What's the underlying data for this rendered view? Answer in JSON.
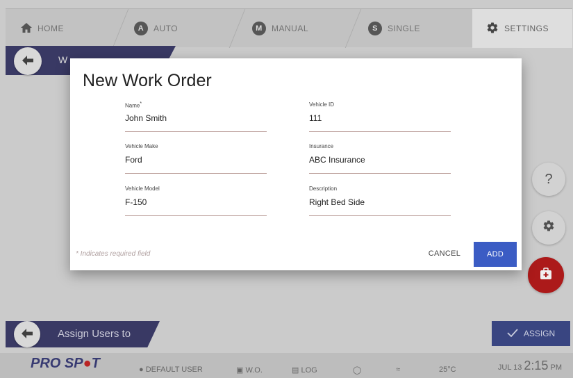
{
  "tabs": [
    {
      "label": "HOME",
      "icon": "home-icon"
    },
    {
      "label": "AUTO",
      "badge": "A"
    },
    {
      "label": "MANUAL",
      "badge": "M"
    },
    {
      "label": "SINGLE",
      "badge": "S"
    },
    {
      "label": "SETTINGS",
      "icon": "gear-icon"
    }
  ],
  "background": {
    "strip_label": "W",
    "assign_strip_label": "Assign Users to",
    "assign_button_label": "ASSIGN",
    "help_label": "?"
  },
  "dialog": {
    "title": "New Work Order",
    "fields": {
      "name": {
        "label": "Name",
        "required_mark": "*",
        "value": "John Smith"
      },
      "vehicle_id": {
        "label": "Vehicle ID",
        "value": "111"
      },
      "vehicle_make": {
        "label": "Vehicle Make",
        "value": "Ford"
      },
      "insurance": {
        "label": "Insurance",
        "value": "ABC Insurance"
      },
      "vehicle_model": {
        "label": "Vehicle Model",
        "value": "F-150"
      },
      "description": {
        "label": "Description",
        "value": "Right Bed Side"
      }
    },
    "required_note": "* Indicates required field",
    "cancel_label": "CANCEL",
    "add_label": "ADD"
  },
  "statusbar": {
    "logo_pre": "PRO SP",
    "logo_dot": "●",
    "logo_post": "T",
    "user": "DEFAULT USER",
    "wo": "W.O.",
    "log": "LOG",
    "temperature": "25°C",
    "date": "JUL 13",
    "time": "2:15",
    "ampm": "PM"
  },
  "colors": {
    "accent_blue": "#3b5cc4",
    "strip_navy": "#3d3d6b",
    "alert_red": "#b71c1c"
  }
}
